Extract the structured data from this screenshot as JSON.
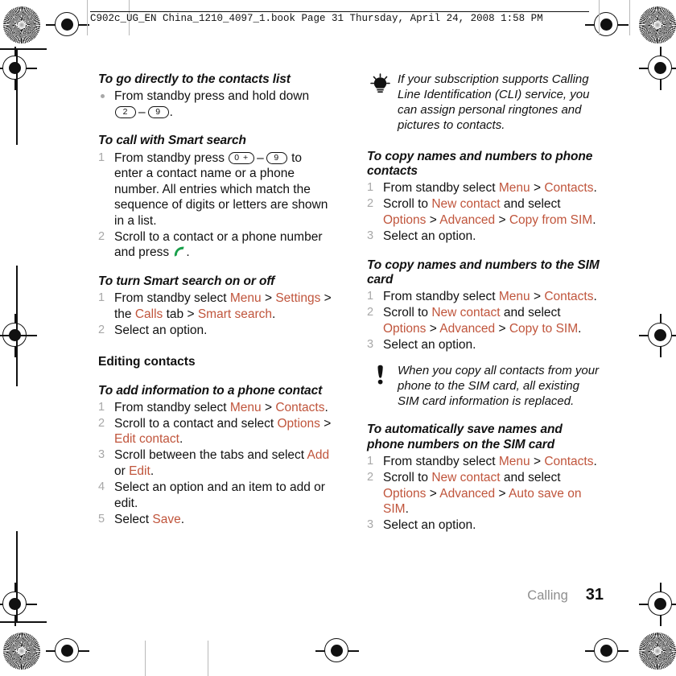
{
  "header": {
    "text": "C902c_UG_EN China_1210_4097_1.book  Page 31  Thursday, April 24, 2008  1:58 PM"
  },
  "colors": {
    "ui_term": "#c0553c",
    "step_number": "#a8a8a8",
    "body_text": "#111111",
    "footer_section": "#8e8e8e",
    "call_icon_green": "#19a04b"
  },
  "left_column": {
    "section1": {
      "heading": "To go directly to the contacts list",
      "bullet_pre": "From standby press and hold down",
      "key_from": "2",
      "key_to": "9",
      "bullet_post": "."
    },
    "section2": {
      "heading": "To call with Smart search",
      "step1_pre": "From standby press",
      "step1_key_from": "0 +",
      "step1_key_to": "9",
      "step1_post": "to enter a contact name or a phone number. All entries which match the sequence of digits or letters are shown in a list.",
      "step2_pre": "Scroll to a contact or a phone number and press",
      "step2_post": "."
    },
    "section3": {
      "heading": "To turn Smart search on or off",
      "step1_a": "From standby select ",
      "step1_menu": "Menu",
      "step1_gt1": " > ",
      "step1_settings": "Settings",
      "step1_b": " > the ",
      "step1_calls": "Calls",
      "step1_c": " tab > ",
      "step1_smart": "Smart search",
      "step1_d": ".",
      "step2": "Select an option."
    },
    "group_heading": "Editing contacts",
    "section4": {
      "heading": "To add information to a phone contact",
      "step1_a": "From standby select ",
      "step1_menu": "Menu",
      "step1_gt": " > ",
      "step1_contacts": "Contacts",
      "step1_end": ".",
      "step2_a": "Scroll to a contact and select ",
      "step2_options": "Options",
      "step2_b": " > ",
      "step2_edit": "Edit contact",
      "step2_end": ".",
      "step3_a": "Scroll between the tabs and select ",
      "step3_add": "Add",
      "step3_b": " or ",
      "step3_edit": "Edit",
      "step3_end": ".",
      "step4": "Select an option and an item to add or edit.",
      "step5_a": "Select ",
      "step5_save": "Save",
      "step5_end": "."
    }
  },
  "right_column": {
    "tip": {
      "icon": "lightbulb-icon",
      "text": "If your subscription supports Calling Line Identification (CLI) service, you can assign personal ringtones and pictures to contacts."
    },
    "section1": {
      "heading": "To copy names and numbers to phone contacts",
      "step1_a": "From standby select ",
      "step1_menu": "Menu",
      "step1_gt": " > ",
      "step1_contacts": "Contacts",
      "step1_end": ".",
      "step2_a": "Scroll to ",
      "step2_new": "New contact",
      "step2_b": " and select ",
      "step2_options": "Options",
      "step2_gt1": " > ",
      "step2_advanced": "Advanced",
      "step2_gt2": " > ",
      "step2_target": "Copy from SIM",
      "step2_end": ".",
      "step3": "Select an option."
    },
    "section2": {
      "heading": "To copy names and numbers to the SIM card",
      "step1_a": "From standby select ",
      "step1_menu": "Menu",
      "step1_gt": " > ",
      "step1_contacts": "Contacts",
      "step1_end": ".",
      "step2_a": "Scroll to ",
      "step2_new": "New contact",
      "step2_b": " and select ",
      "step2_options": "Options",
      "step2_gt1": " > ",
      "step2_advanced": "Advanced",
      "step2_gt2": " > ",
      "step2_target": "Copy to SIM",
      "step2_end": ".",
      "step3": "Select an option."
    },
    "note": {
      "icon": "exclamation-icon",
      "text": "When you copy all contacts from your phone to the SIM card, all existing SIM card information is replaced."
    },
    "section3": {
      "heading": "To automatically save names and phone numbers on the SIM card",
      "step1_a": "From standby select ",
      "step1_menu": "Menu",
      "step1_gt": " > ",
      "step1_contacts": "Contacts",
      "step1_end": ".",
      "step2_a": "Scroll to ",
      "step2_new": "New contact",
      "step2_b": " and select ",
      "step2_options": "Options",
      "step2_gt1": " > ",
      "step2_advanced": "Advanced",
      "step2_gt2": " > ",
      "step2_target": "Auto save on SIM",
      "step2_end": ".",
      "step3": "Select an option."
    }
  },
  "footer": {
    "section": "Calling",
    "page_number": "31"
  }
}
